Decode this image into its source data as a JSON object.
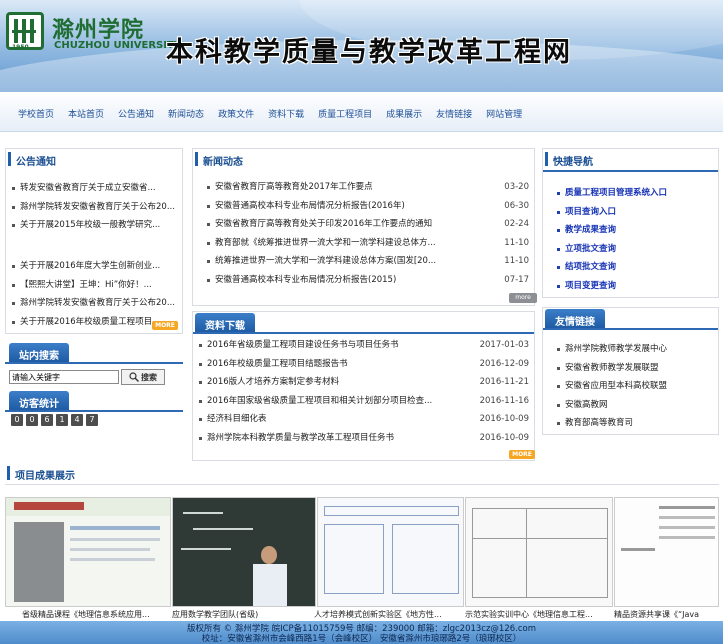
{
  "header": {
    "logo_cn": "滁州学院",
    "logo_en": "CHUZHOU UNIVERSITY",
    "logo_year": "1950",
    "site_title": "本科教学质量与教学改革工程网"
  },
  "nav": [
    "学校首页",
    "本站首页",
    "公告通知",
    "新闻动态",
    "政策文件",
    "资料下载",
    "质量工程项目",
    "成果展示",
    "友情链接",
    "网站管理"
  ],
  "notice": {
    "title": "公告通知",
    "items": [
      "转发安徽省教育厅关于成立安徽省...",
      "滁州学院转发安徽省教育厅关于公布20...",
      "关于开展2015年校级一般教学研究...",
      "关于开展2016年度大学生创新创业...",
      "【熙熙大讲堂】王坤：Hi”你好！...",
      "滁州学院转发安徽省教育厅关于公布20...",
      "关于开展2016年校级质量工程项目..."
    ],
    "more": "MORE"
  },
  "news": {
    "title": "新闻动态",
    "items": [
      {
        "text": "安徽省教育厅高等教育处2017年工作要点",
        "date": "03-20"
      },
      {
        "text": "安徽普通高校本科专业布局情况分析报告(2016年)",
        "date": "06-30"
      },
      {
        "text": "安徽省教育厅高等教育处关于印发2016年工作要点的通知",
        "date": "02-24"
      },
      {
        "text": "教育部就《统筹推进世界一流大学和一流学科建设总体方...",
        "date": "11-10"
      },
      {
        "text": "统筹推进世界一流大学和一流学科建设总体方案(国发[20...",
        "date": "11-10"
      },
      {
        "text": "安徽普通高校本科专业布局情况分析报告(2015)",
        "date": "07-17"
      }
    ],
    "more": "more"
  },
  "quicknav": {
    "title": "快捷导航",
    "items": [
      "质量工程项目管理系统入口",
      "项目查询入口",
      "教学成果查询",
      "立项批文查询",
      "结项批文查询",
      "项目变更查询"
    ]
  },
  "downloads": {
    "title": "资料下载",
    "items": [
      {
        "text": "2016年省级质量工程项目建设任务书与项目任务书",
        "date": "2017-01-03"
      },
      {
        "text": "2016年校级质量工程项目结题报告书",
        "date": "2016-12-09"
      },
      {
        "text": "2016版人才培养方案制定参考材料",
        "date": "2016-11-21"
      },
      {
        "text": "2016年国家级省级质量工程项目和相关计划部分项目检查...",
        "date": "2016-11-16"
      },
      {
        "text": "经济科目细化表",
        "date": "2016-10-09"
      },
      {
        "text": "滁州学院本科教学质量与教学改革工程项目任务书",
        "date": "2016-10-09"
      }
    ],
    "more": "MORE"
  },
  "links": {
    "title": "友情链接",
    "items": [
      "滁州学院教师教学发展中心",
      "安徽省教师教学发展联盟",
      "安徽省应用型本科高校联盟",
      "安徽高教网",
      "教育部高等教育司"
    ]
  },
  "search": {
    "title": "站内搜索",
    "placeholder": "请输入关键字",
    "button": "搜索"
  },
  "visitors": {
    "title": "访客统计",
    "digits": [
      "0",
      "0",
      "6",
      "1",
      "4",
      "7"
    ]
  },
  "projects": {
    "title": "项目成果展示",
    "captions": [
      "省级精品课程《地理信息系统应用...",
      "应用数学教学团队(省级)",
      "人才培养模式创新实验区《地方性...",
      "示范实验实训中心《地理信息工程...",
      "精品资源共享课《“Java"
    ]
  },
  "footer": {
    "line1": "版权所有 © 滁州学院   皖ICP备11015759号   邮编：239000  邮箱：zlgc2013cz@126.com",
    "line2": "校址：安徽省滁州市会峰西路1号（会峰校区）   安徽省滁州市琅琊路2号（琅琊校区）"
  }
}
